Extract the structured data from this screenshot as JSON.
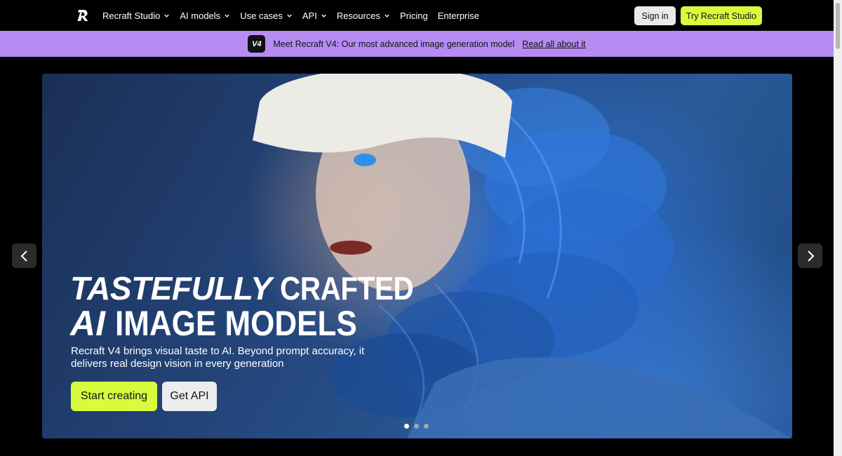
{
  "nav": {
    "logo_icon": "recraft-logo-icon",
    "items": [
      {
        "label": "Recraft Studio",
        "has_dropdown": true
      },
      {
        "label": "AI models",
        "has_dropdown": true
      },
      {
        "label": "Use cases",
        "has_dropdown": true
      },
      {
        "label": "API",
        "has_dropdown": true
      },
      {
        "label": "Resources",
        "has_dropdown": true
      },
      {
        "label": "Pricing",
        "has_dropdown": false
      },
      {
        "label": "Enterprise",
        "has_dropdown": false
      }
    ],
    "signin_label": "Sign in",
    "try_label": "Try Recraft Studio"
  },
  "announcement": {
    "badge": "V4",
    "text": "Meet Recraft V4: Our most advanced image generation model",
    "link": "Read all about it"
  },
  "hero": {
    "title_line1_a": "TASTEFULLY",
    "title_line1_b": "CRAFTED",
    "title_line2_a": "AI",
    "title_line2_b": "IMAGE MODELS",
    "subtitle": "Recraft V4 brings visual taste to AI. Beyond prompt accuracy, it delivers real design vision in every generation",
    "primary_cta": "Start creating",
    "secondary_cta": "Get API",
    "slide_count": 3,
    "active_slide": 1
  },
  "colors": {
    "accent_lime": "#d8fb3d",
    "announcement_bg": "#b68cf3",
    "background": "#000000"
  }
}
